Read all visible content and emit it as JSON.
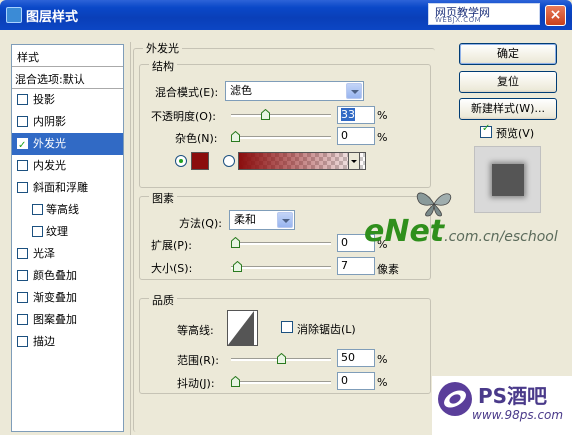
{
  "window": {
    "title": "图层样式",
    "watermark_top": "网页教学网",
    "watermark_top_sub": "WEBJX.COM"
  },
  "left": {
    "header": "样式",
    "blend": "混合选项:默认",
    "items": [
      {
        "label": "投影",
        "checked": false,
        "selected": false,
        "indent": false
      },
      {
        "label": "内阴影",
        "checked": false,
        "selected": false,
        "indent": false
      },
      {
        "label": "外发光",
        "checked": true,
        "selected": true,
        "indent": false
      },
      {
        "label": "内发光",
        "checked": false,
        "selected": false,
        "indent": false
      },
      {
        "label": "斜面和浮雕",
        "checked": false,
        "selected": false,
        "indent": false
      },
      {
        "label": "等高线",
        "checked": false,
        "selected": false,
        "indent": true
      },
      {
        "label": "纹理",
        "checked": false,
        "selected": false,
        "indent": true
      },
      {
        "label": "光泽",
        "checked": false,
        "selected": false,
        "indent": false
      },
      {
        "label": "颜色叠加",
        "checked": false,
        "selected": false,
        "indent": false
      },
      {
        "label": "渐变叠加",
        "checked": false,
        "selected": false,
        "indent": false
      },
      {
        "label": "图案叠加",
        "checked": false,
        "selected": false,
        "indent": false
      },
      {
        "label": "描边",
        "checked": false,
        "selected": false,
        "indent": false
      }
    ]
  },
  "main": {
    "outer_title": "外发光",
    "structure": {
      "title": "结构",
      "blend_label": "混合模式(E):",
      "blend_value": "滤色",
      "opacity_label": "不透明度(O):",
      "opacity_value": "33",
      "opacity_level": 0.33,
      "noise_label": "杂色(N):",
      "noise_value": "0",
      "noise_level": 0,
      "color_hex": "#8b0d0d"
    },
    "elements": {
      "title": "图素",
      "method_label": "方法(Q):",
      "method_value": "柔和",
      "spread_label": "扩展(P):",
      "spread_value": "0",
      "spread_level": 0,
      "size_label": "大小(S):",
      "size_value": "7",
      "size_unit": "像素"
    },
    "quality": {
      "title": "品质",
      "contour_label": "等高线:",
      "antialias_label": "消除锯齿(L)",
      "range_label": "范围(R):",
      "range_value": "50",
      "range_level": 0.5,
      "jitter_label": "抖动(J):",
      "jitter_value": "0",
      "jitter_level": 0
    },
    "percent": "%"
  },
  "right": {
    "ok": "确定",
    "reset": "复位",
    "new_style": "新建样式(W)...",
    "preview_label": "预览(V)",
    "preview_checked": true
  },
  "watermarks": {
    "enet_brand": "eNet",
    "enet_domain": ".com.cn/eschool",
    "ps_brand": "PS酒吧",
    "ps_url": "www.98ps.com"
  }
}
